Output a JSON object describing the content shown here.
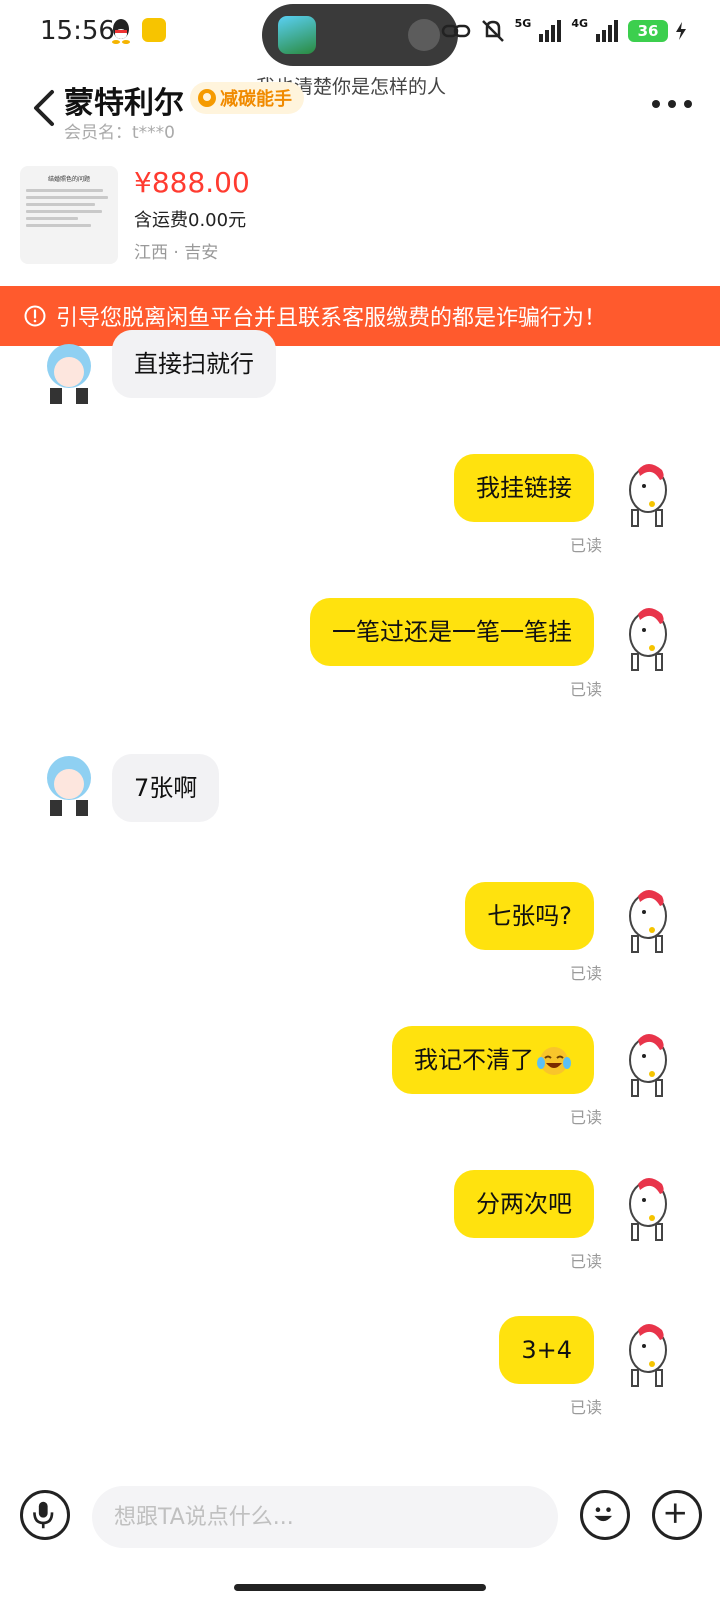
{
  "status_bar": {
    "time": "15:56",
    "battery": "36",
    "network_1": "5G",
    "network_2": "4G",
    "island_caption": "我也清楚你是怎样的人"
  },
  "header": {
    "seller_name": "蒙特利尔",
    "badge": "减碳能手",
    "member": "会员名：t***0"
  },
  "product": {
    "thumb_title": "结婚照色的问题",
    "price": "¥888.00",
    "shipping": "含运费0.00元",
    "location": "江西 · 吉安"
  },
  "warning": {
    "text": "引导您脱离闲鱼平台并且联系客服缴费的都是诈骗行为！"
  },
  "messages": [
    {
      "side": "in",
      "text": "直接扫就行"
    },
    {
      "side": "out",
      "text": "我挂链接",
      "status": "已读"
    },
    {
      "side": "out",
      "text": "一笔过还是一笔一笔挂",
      "status": "已读"
    },
    {
      "side": "in",
      "text": "7张啊"
    },
    {
      "side": "out",
      "text": "七张吗?",
      "status": "已读"
    },
    {
      "side": "out",
      "text": "我记不清了",
      "status": "已读"
    },
    {
      "side": "out",
      "text": "分两次吧",
      "status": "已读"
    },
    {
      "side": "out",
      "text": "3+4",
      "status": "已读"
    }
  ],
  "input": {
    "placeholder": "想跟TA说点什么..."
  },
  "icons": {
    "back": "chevron-left-icon",
    "more": "more-icon",
    "warning": "alert-circle-icon",
    "mic": "microphone-icon",
    "emoji": "emoji-icon",
    "plus": "plus-icon"
  },
  "colors": {
    "accent": "#ffe20e",
    "warning_bg": "#ff5a2d",
    "price": "#ff3b30"
  }
}
